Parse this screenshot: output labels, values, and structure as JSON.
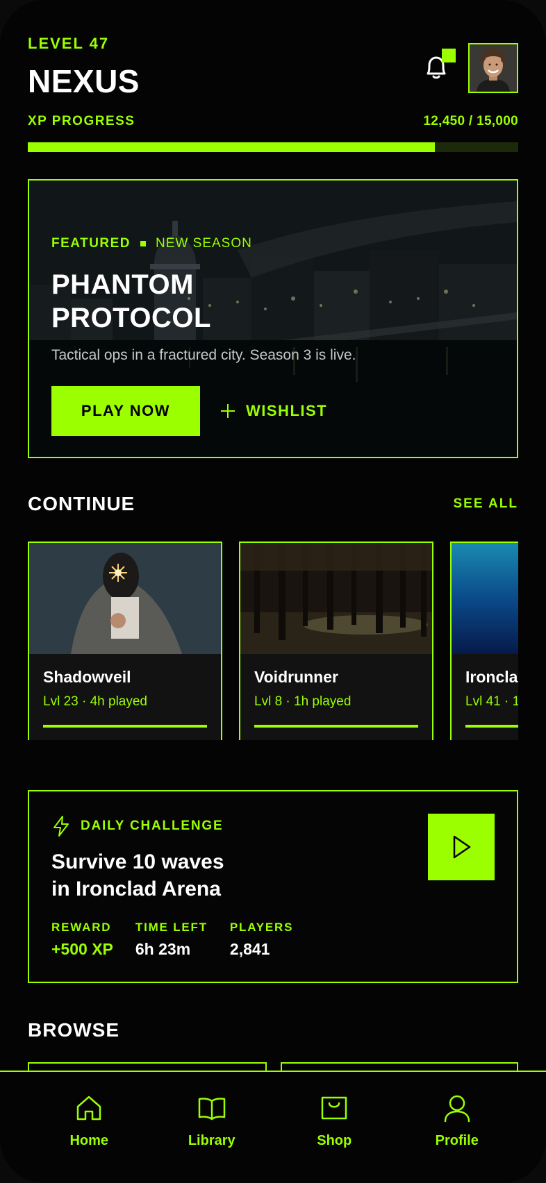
{
  "header": {
    "level": "LEVEL 47",
    "title": "NEXUS",
    "xp_label": "XP PROGRESS",
    "xp_value": "12,450 / 15,000",
    "xp_fraction": 0.83
  },
  "featured": {
    "tag": "FEATURED",
    "tag2": "NEW SEASON",
    "title_line1": "PHANTOM",
    "title_line2": "PROTOCOL",
    "description": "Tactical ops in a fractured city. Season 3 is live.",
    "play_label": "PLAY NOW",
    "wishlist_label": "WISHLIST"
  },
  "continue": {
    "title": "CONTINUE",
    "see_all": "SEE ALL",
    "cards": [
      {
        "name": "Shadowveil",
        "meta": "Lvl 23 · 4h played",
        "progress": 1.0
      },
      {
        "name": "Voidrunner",
        "meta": "Lvl 8 · 1h played",
        "progress": 1.0
      },
      {
        "name": "Ironclad",
        "meta": "Lvl 41 · 1",
        "progress": 1.0
      }
    ]
  },
  "daily": {
    "tag": "DAILY CHALLENGE",
    "title_line1": "Survive 10 waves",
    "title_line2": "in Ironclad Arena",
    "stats": [
      {
        "label": "REWARD",
        "value": "+500 XP"
      },
      {
        "label": "TIME LEFT",
        "value": "6h 23m"
      },
      {
        "label": "PLAYERS",
        "value": "2,841"
      }
    ]
  },
  "browse": {
    "title": "BROWSE"
  },
  "tabbar": {
    "items": [
      {
        "label": "Home",
        "icon": "home-icon"
      },
      {
        "label": "Library",
        "icon": "book-icon"
      },
      {
        "label": "Shop",
        "icon": "shopping-bag-icon"
      },
      {
        "label": "Profile",
        "icon": "user-icon"
      }
    ]
  },
  "colors": {
    "accent": "#9bff00",
    "background": "#040404",
    "card": "#121212"
  }
}
